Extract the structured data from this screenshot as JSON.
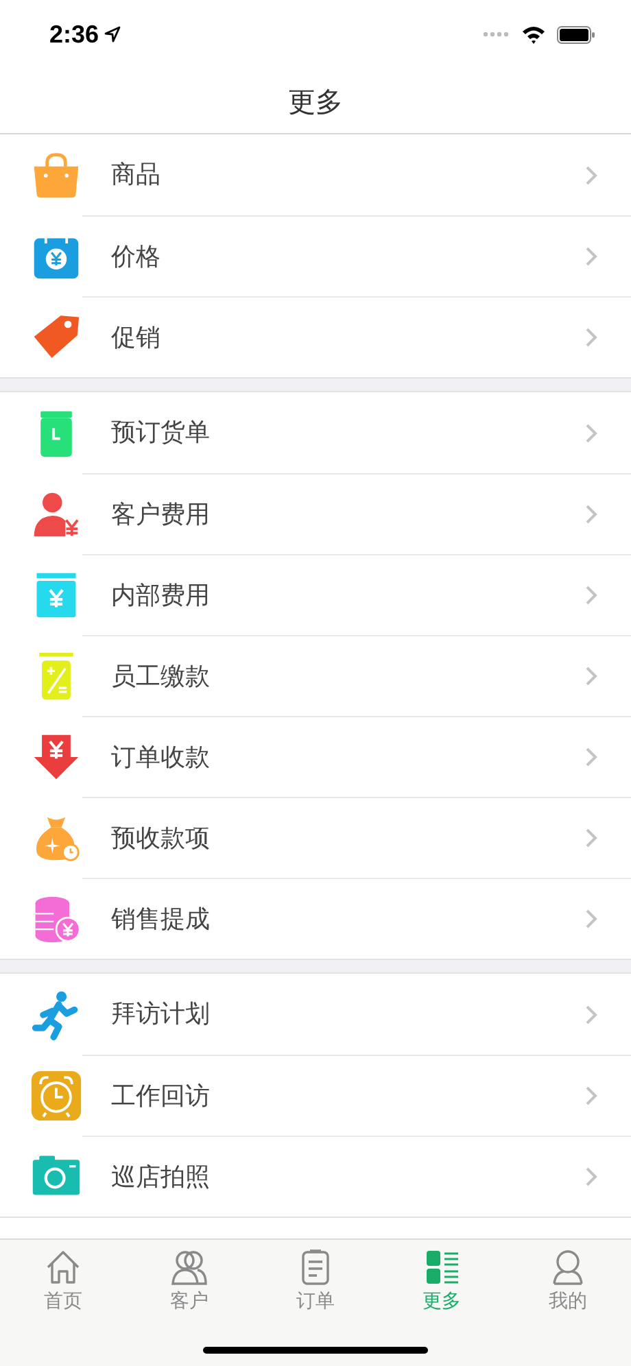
{
  "status_bar": {
    "time": "2:36"
  },
  "nav_bar": {
    "title": "更多"
  },
  "groups": [
    {
      "items": [
        {
          "label": "商品"
        },
        {
          "label": "价格"
        },
        {
          "label": "促销"
        }
      ]
    },
    {
      "items": [
        {
          "label": "预订货单"
        },
        {
          "label": "客户费用"
        },
        {
          "label": "内部费用"
        },
        {
          "label": "员工缴款"
        },
        {
          "label": "订单收款"
        },
        {
          "label": "预收款项"
        },
        {
          "label": "销售提成"
        }
      ]
    },
    {
      "items": [
        {
          "label": "拜访计划"
        },
        {
          "label": "工作回访"
        },
        {
          "label": "巡店拍照"
        }
      ]
    }
  ],
  "tab_bar": [
    {
      "label": "首页",
      "selected": false
    },
    {
      "label": "客户",
      "selected": false
    },
    {
      "label": "订单",
      "selected": false
    },
    {
      "label": "更多",
      "selected": true
    },
    {
      "label": "我的",
      "selected": false
    }
  ]
}
